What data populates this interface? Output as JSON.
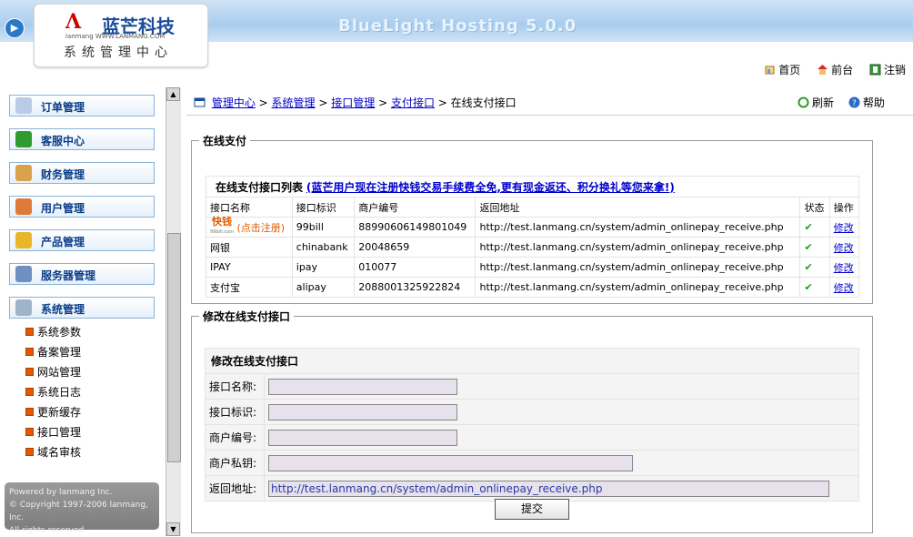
{
  "header": {
    "product": "BlueLight Hosting 5.0.0",
    "logo_mark": "Λ",
    "logo_cn": "蓝芒科技",
    "logo_en": "lanmang  WWW.LANMANG.COM",
    "logo_sub": "系统管理中心",
    "links": [
      "首页",
      "前台",
      "注销"
    ]
  },
  "sidebar": {
    "menu": [
      "订单管理",
      "客服中心",
      "财务管理",
      "用户管理",
      "产品管理",
      "服务器管理",
      "系统管理"
    ],
    "submenu": [
      "系统参数",
      "备案管理",
      "网站管理",
      "系统日志",
      "更新缓存",
      "接口管理",
      "域名审核"
    ],
    "powered": [
      "Powered by lanmang Inc.",
      "© Copyright 1997-2006 lanmang, Inc.",
      "All rights reserved"
    ]
  },
  "breadcrumb": [
    "管理中心",
    "系统管理",
    "接口管理",
    "支付接口",
    "在线支付接口"
  ],
  "tools": [
    "刷新",
    "帮助"
  ],
  "online_pay": {
    "legend": "在线支付",
    "list_title": "在线支付接口列表",
    "promo": "(蓝芒用户现在注册快钱交易手续费全免,更有现金返还、积分换礼等您来拿!)",
    "columns": [
      "接口名称",
      "接口标识",
      "商户编号",
      "返回地址",
      "状态",
      "操作"
    ],
    "rows": [
      {
        "name_logo": "快钱",
        "name_logo_sub": "99bill.com",
        "name": "(点击注册)",
        "id": "99bill",
        "merchant": "88990606149801049",
        "url": "http://test.lanmang.cn/system/admin_onlinepay_receive.php",
        "status": "✔",
        "op": "修改"
      },
      {
        "name": "网银",
        "id": "chinabank",
        "merchant": "20048659",
        "url": "http://test.lanmang.cn/system/admin_onlinepay_receive.php",
        "status": "✔",
        "op": "修改"
      },
      {
        "name": "IPAY",
        "id": "ipay",
        "merchant": "010077",
        "url": "http://test.lanmang.cn/system/admin_onlinepay_receive.php",
        "status": "✔",
        "op": "修改"
      },
      {
        "name": "支付宝",
        "id": "alipay",
        "merchant": "2088001325922824",
        "url": "http://test.lanmang.cn/system/admin_onlinepay_receive.php",
        "status": "✔",
        "op": "修改"
      }
    ]
  },
  "edit_form": {
    "legend": "修改在线支付接口",
    "title": "修改在线支付接口",
    "labels": [
      "接口名称:",
      "接口标识:",
      "商户编号:",
      "商户私钥:",
      "返回地址:"
    ],
    "values": [
      "",
      "",
      "",
      "",
      "http://test.lanmang.cn/system/admin_onlinepay_receive.php"
    ],
    "submit": "提交"
  },
  "colors": {
    "accent": "#0a3d88",
    "check": "#1aa01a",
    "bar": "#a9cdee"
  }
}
